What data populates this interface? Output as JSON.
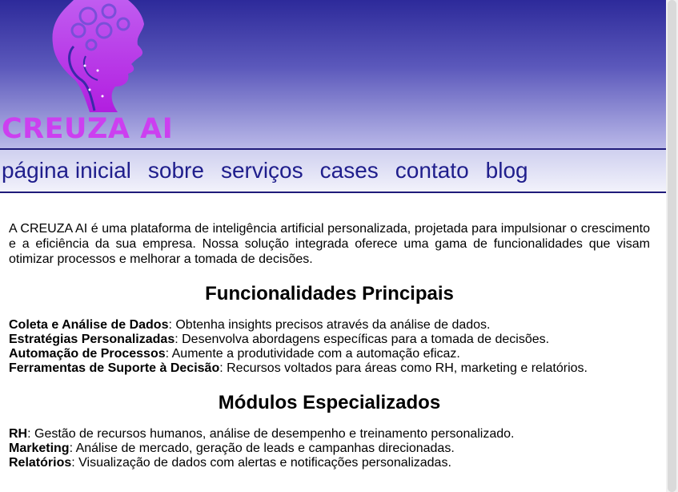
{
  "logo": {
    "text": "CREUZA AI",
    "color": "#cc3ff0"
  },
  "nav": {
    "items": [
      "página inicial",
      "sobre",
      "serviços",
      "cases",
      "contato",
      "blog"
    ],
    "color": "#1f1e8c"
  },
  "intro": "A CREUZA AI é uma plataforma de inteligência artificial personalizada, projetada para impulsionar o crescimento e a eficiência da sua empresa. Nossa solução integrada oferece uma gama de funcionalidades que visam otimizar processos e melhorar a tomada de decisões.",
  "features": {
    "title": "Funcionalidades Principais",
    "items": [
      {
        "term": "Coleta e Análise de Dados",
        "desc": ": Obtenha insights precisos através da análise de dados."
      },
      {
        "term": "Estratégias Personalizadas",
        "desc": ": Desenvolva abordagens específicas para a tomada de decisões."
      },
      {
        "term": "Automação de Processos",
        "desc": ": Aumente a produtividade com a automação eficaz."
      },
      {
        "term": "Ferramentas de Suporte à Decisão",
        "desc": ": Recursos voltados para áreas como RH, marketing e relatórios."
      }
    ]
  },
  "modules": {
    "title": "Módulos Especializados",
    "items": [
      {
        "term": "RH",
        "desc": ": Gestão de recursos humanos, análise de desempenho e treinamento personalizado."
      },
      {
        "term": "Marketing",
        "desc": ": Análise de mercado, geração de leads e campanhas direcionadas."
      },
      {
        "term": "Relatórios",
        "desc": ": Visualização de dados com alertas e notificações personalizadas."
      }
    ]
  }
}
